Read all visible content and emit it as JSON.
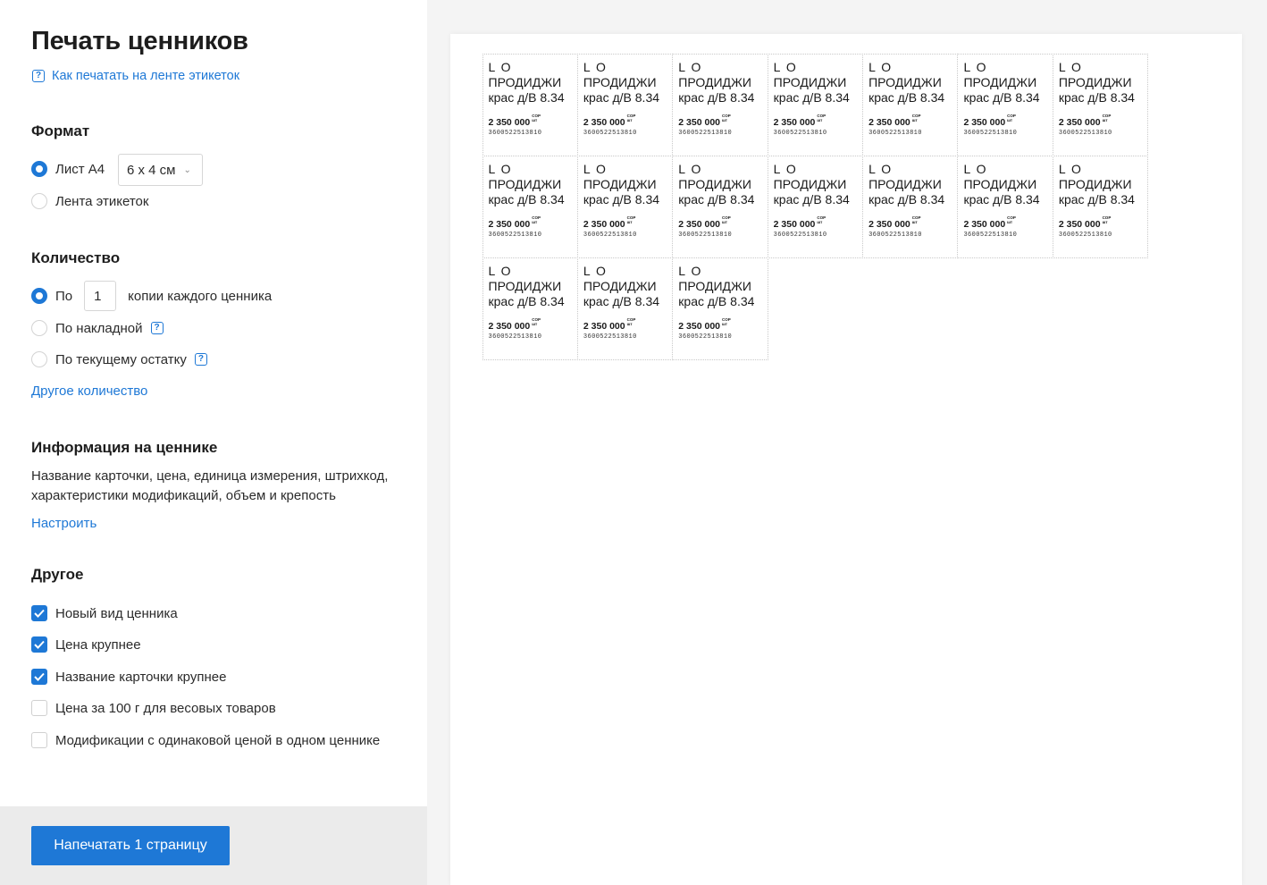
{
  "header": {
    "title": "Печать ценников",
    "help_link": "Как печатать на ленте этикеток"
  },
  "format": {
    "title": "Формат",
    "options": [
      "Лист A4",
      "Лента этикеток"
    ],
    "selected": 0,
    "size_select_value": "6 х 4 см"
  },
  "quantity": {
    "title": "Количество",
    "option_per_prefix": "По",
    "copies_value": "1",
    "option_per_suffix": "копии каждого ценника",
    "option_invoice": "По накладной",
    "option_stock": "По текущему остатку",
    "other_link": "Другое количество"
  },
  "info": {
    "title": "Информация на ценнике",
    "description": "Название карточки, цена, единица измерения, штрихкод, характеристики модификаций, объем и крепость",
    "configure_link": "Настроить"
  },
  "other": {
    "title": "Другое",
    "options": [
      {
        "label": "Новый вид ценника",
        "checked": true
      },
      {
        "label": "Цена крупнее",
        "checked": true
      },
      {
        "label": "Название карточки крупнее",
        "checked": true
      },
      {
        "label": "Цена за 100 г для весовых товаров",
        "checked": false
      },
      {
        "label": "Модификации с одинаковой ценой в одном ценнике",
        "checked": false
      }
    ]
  },
  "footer": {
    "print_button": "Напечатать 1 страницу"
  },
  "preview": {
    "label_count": 17,
    "label": {
      "brand": "L O",
      "name_line1": "ПРОДИДЖИ",
      "name_line2": "крас д/В 8.34",
      "price": "2 350 000",
      "currency_top": "COP",
      "currency_bottom": "шт",
      "barcode": "3600522513810"
    }
  },
  "colors": {
    "accent": "#1e78d6",
    "footer_bg": "#ebebeb",
    "page_bg": "#f4f4f4"
  }
}
